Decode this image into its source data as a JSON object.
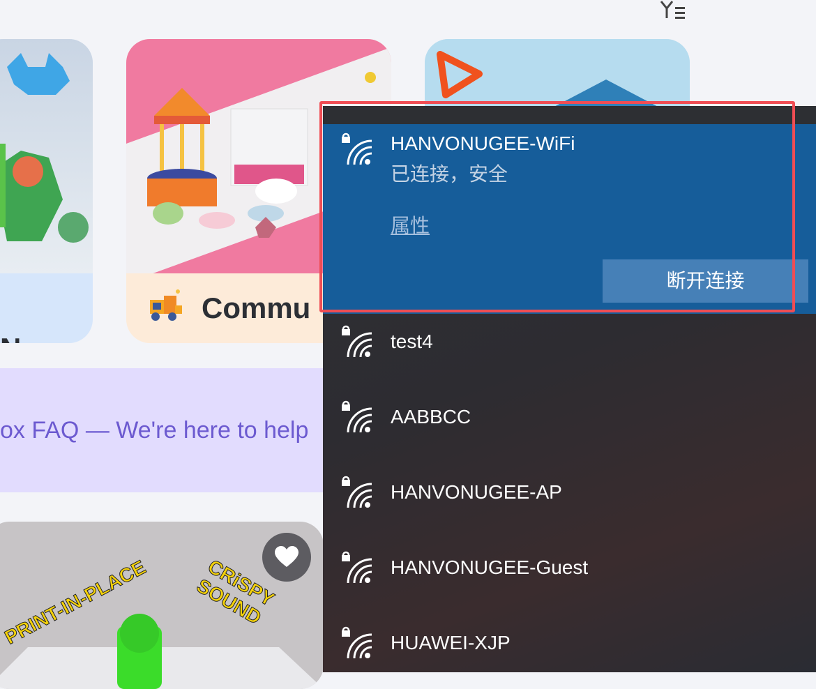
{
  "cards": {
    "left": {
      "caption": "N"
    },
    "middle": {
      "caption": "Commu"
    }
  },
  "faq_banner": {
    "text": "ox FAQ  —  We're here to help"
  },
  "video": {
    "sticker_left": "PRINT-IN-PLACE",
    "sticker_right": "CRiSPY SOUND"
  },
  "wifi": {
    "connected": {
      "name": "HANVONUGEE-WiFi",
      "status": "已连接，安全",
      "properties_label": "属性",
      "disconnect_label": "断开连接"
    },
    "networks": [
      {
        "name": "test4"
      },
      {
        "name": "AABBCC"
      },
      {
        "name": "HANVONUGEE-AP"
      },
      {
        "name": "HANVONUGEE-Guest"
      },
      {
        "name": "HUAWEI-XJP"
      }
    ]
  },
  "colors": {
    "accent_blue": "#165d9a",
    "highlight_red": "#ef4d54",
    "faq_text": "#6c5ad0"
  }
}
